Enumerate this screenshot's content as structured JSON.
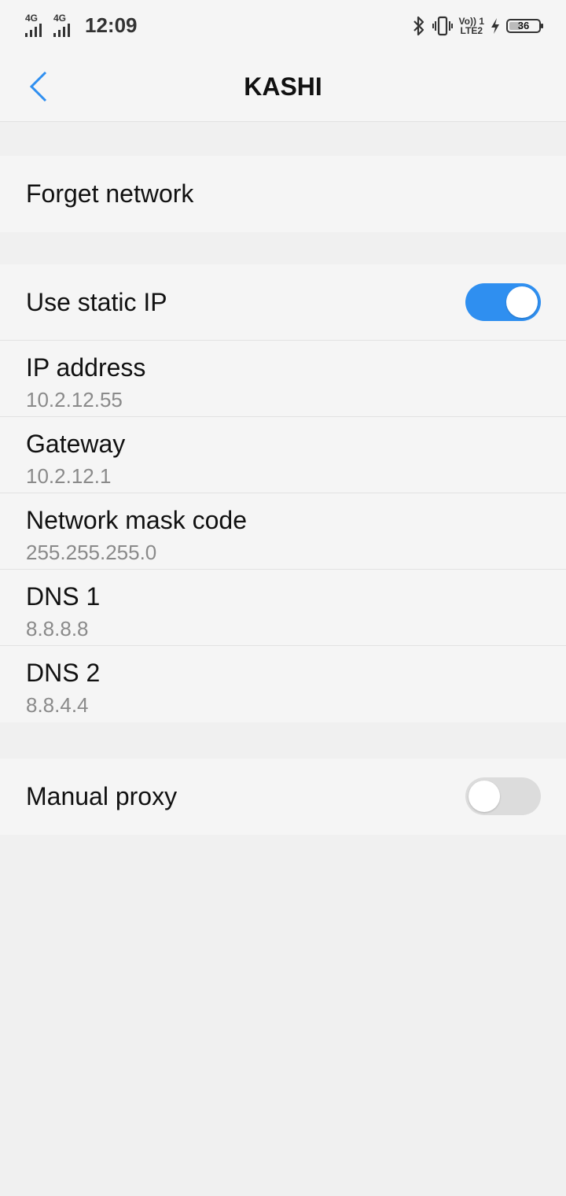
{
  "status_bar": {
    "sim1_label": "4G",
    "sim2_label": "4G",
    "time": "12:09",
    "volte_top": "Vo)) 1",
    "volte_bottom": "LTE2",
    "battery_level": "36",
    "icons": [
      "bluetooth-icon",
      "vibrate-icon",
      "charging-icon"
    ]
  },
  "header": {
    "title": "KASHI",
    "back_icon": "chevron-left-icon",
    "accent_color": "#2f8ff0"
  },
  "forget_network": {
    "label": "Forget network"
  },
  "static_ip": {
    "label": "Use static IP",
    "enabled": true,
    "fields": [
      {
        "label": "IP address",
        "value": "10.2.12.55"
      },
      {
        "label": "Gateway",
        "value": "10.2.12.1"
      },
      {
        "label": "Network mask code",
        "value": "255.255.255.0"
      },
      {
        "label": "DNS 1",
        "value": "8.8.8.8"
      },
      {
        "label": "DNS 2",
        "value": "8.8.4.4"
      }
    ]
  },
  "manual_proxy": {
    "label": "Manual proxy",
    "enabled": false
  }
}
